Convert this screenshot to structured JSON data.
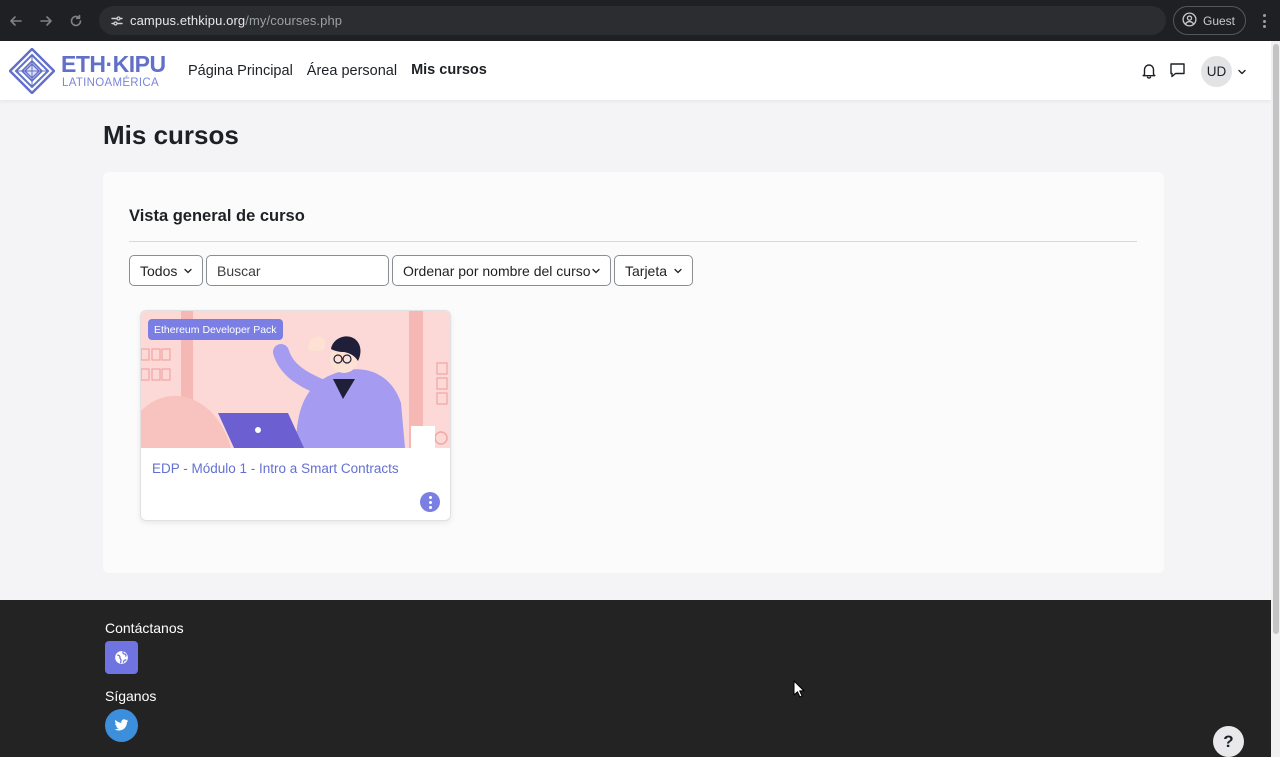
{
  "browser": {
    "url_domain": "campus.ethkipu.org",
    "url_path": "/my/courses.php",
    "profile_label": "Guest",
    "icons": [
      "back-arrow-icon",
      "forward-arrow-icon",
      "reload-icon",
      "site-settings-icon",
      "profile-icon",
      "menu-dots-icon"
    ]
  },
  "header": {
    "logo_line1": "ETH·KIPU",
    "logo_line2": "LATINOAMÉRICA",
    "nav": [
      {
        "label": "Página Principal",
        "active": false
      },
      {
        "label": "Área personal",
        "active": false
      },
      {
        "label": "Mis cursos",
        "active": true
      }
    ],
    "user_initials": "UD",
    "icons": [
      "bell-icon",
      "message-icon",
      "chevron-down-icon"
    ]
  },
  "main": {
    "title": "Mis cursos",
    "panel_title": "Vista general de curso",
    "filters": {
      "grouping": "Todos",
      "search_placeholder": "Buscar",
      "sort": "Ordenar por nombre del curso",
      "view": "Tarjeta"
    },
    "courses": [
      {
        "category": "Ethereum Developer Pack",
        "name": "EDP - Módulo 1 - Intro a Smart Contracts"
      }
    ]
  },
  "footer": {
    "contact_heading": "Contáctanos",
    "follow_heading": "Síganos",
    "icons": [
      "globe-icon",
      "twitter-icon"
    ]
  },
  "help_label": "?",
  "colors": {
    "accent": "#7b7fe3",
    "link": "#6470d1",
    "footer_bg": "#232323",
    "twitter": "#3d8fdc"
  }
}
